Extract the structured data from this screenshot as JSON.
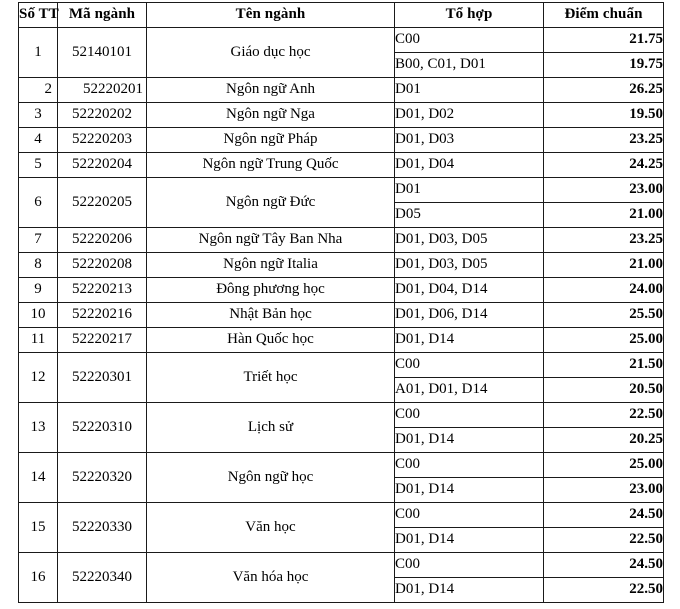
{
  "table": {
    "columns": [
      {
        "key": "stt",
        "label": "Số TT"
      },
      {
        "key": "code",
        "label": "Mã ngành"
      },
      {
        "key": "name",
        "label": "Tên ngành"
      },
      {
        "key": "combo",
        "label": "Tổ hợp"
      },
      {
        "key": "score",
        "label": "Điểm chuẩn"
      }
    ],
    "rows": [
      {
        "stt": "1",
        "code": "52140101",
        "name": "Giáo dục học",
        "align": "center",
        "entries": [
          {
            "combo": "C00",
            "score": "21.75"
          },
          {
            "combo": "B00, C01, D01",
            "score": "19.75"
          }
        ]
      },
      {
        "stt": "2",
        "code": "52220201",
        "name": "Ngôn ngữ Anh",
        "align": "right",
        "entries": [
          {
            "combo": "D01",
            "score": "26.25"
          }
        ]
      },
      {
        "stt": "3",
        "code": "52220202",
        "name": "Ngôn ngữ Nga",
        "align": "center",
        "entries": [
          {
            "combo": "D01, D02",
            "score": "19.50"
          }
        ]
      },
      {
        "stt": "4",
        "code": "52220203",
        "name": "Ngôn ngữ Pháp",
        "align": "center",
        "entries": [
          {
            "combo": "D01, D03",
            "score": "23.25"
          }
        ]
      },
      {
        "stt": "5",
        "code": "52220204",
        "name": "Ngôn ngữ Trung Quốc",
        "align": "center",
        "entries": [
          {
            "combo": "D01, D04",
            "score": "24.25"
          }
        ]
      },
      {
        "stt": "6",
        "code": "52220205",
        "name": "Ngôn ngữ Đức",
        "align": "center",
        "entries": [
          {
            "combo": "D01",
            "score": "23.00"
          },
          {
            "combo": "D05",
            "score": "21.00"
          }
        ]
      },
      {
        "stt": "7",
        "code": "52220206",
        "name": "Ngôn ngữ Tây Ban Nha",
        "align": "center",
        "entries": [
          {
            "combo": "D01, D03, D05",
            "score": "23.25"
          }
        ]
      },
      {
        "stt": "8",
        "code": "52220208",
        "name": "Ngôn ngữ Italia",
        "align": "center",
        "entries": [
          {
            "combo": "D01, D03, D05",
            "score": "21.00"
          }
        ]
      },
      {
        "stt": "9",
        "code": "52220213",
        "name": "Đông phương học",
        "align": "center",
        "entries": [
          {
            "combo": "D01, D04, D14",
            "score": "24.00"
          }
        ]
      },
      {
        "stt": "10",
        "code": "52220216",
        "name": "Nhật Bản học",
        "align": "center",
        "entries": [
          {
            "combo": "D01, D06, D14",
            "score": "25.50"
          }
        ]
      },
      {
        "stt": "11",
        "code": "52220217",
        "name": "Hàn Quốc học",
        "align": "center",
        "entries": [
          {
            "combo": "D01, D14",
            "score": "25.00"
          }
        ]
      },
      {
        "stt": "12",
        "code": "52220301",
        "name": "Triết học",
        "align": "center",
        "entries": [
          {
            "combo": "C00",
            "score": "21.50"
          },
          {
            "combo": "A01, D01, D14",
            "score": "20.50"
          }
        ]
      },
      {
        "stt": "13",
        "code": "52220310",
        "name": "Lịch sử",
        "align": "center",
        "entries": [
          {
            "combo": "C00",
            "score": "22.50"
          },
          {
            "combo": "D01, D14",
            "score": "20.25"
          }
        ]
      },
      {
        "stt": "14",
        "code": "52220320",
        "name": "Ngôn ngữ học",
        "align": "center",
        "entries": [
          {
            "combo": "C00",
            "score": "25.00"
          },
          {
            "combo": "D01, D14",
            "score": "23.00"
          }
        ]
      },
      {
        "stt": "15",
        "code": "52220330",
        "name": "Văn học",
        "align": "center",
        "entries": [
          {
            "combo": "C00",
            "score": "24.50"
          },
          {
            "combo": "D01, D14",
            "score": "22.50"
          }
        ]
      },
      {
        "stt": "16",
        "code": "52220340",
        "name": "Văn hóa học",
        "align": "center",
        "entries": [
          {
            "combo": "C00",
            "score": "24.50"
          },
          {
            "combo": "D01, D14",
            "score": "22.50"
          }
        ]
      }
    ]
  }
}
